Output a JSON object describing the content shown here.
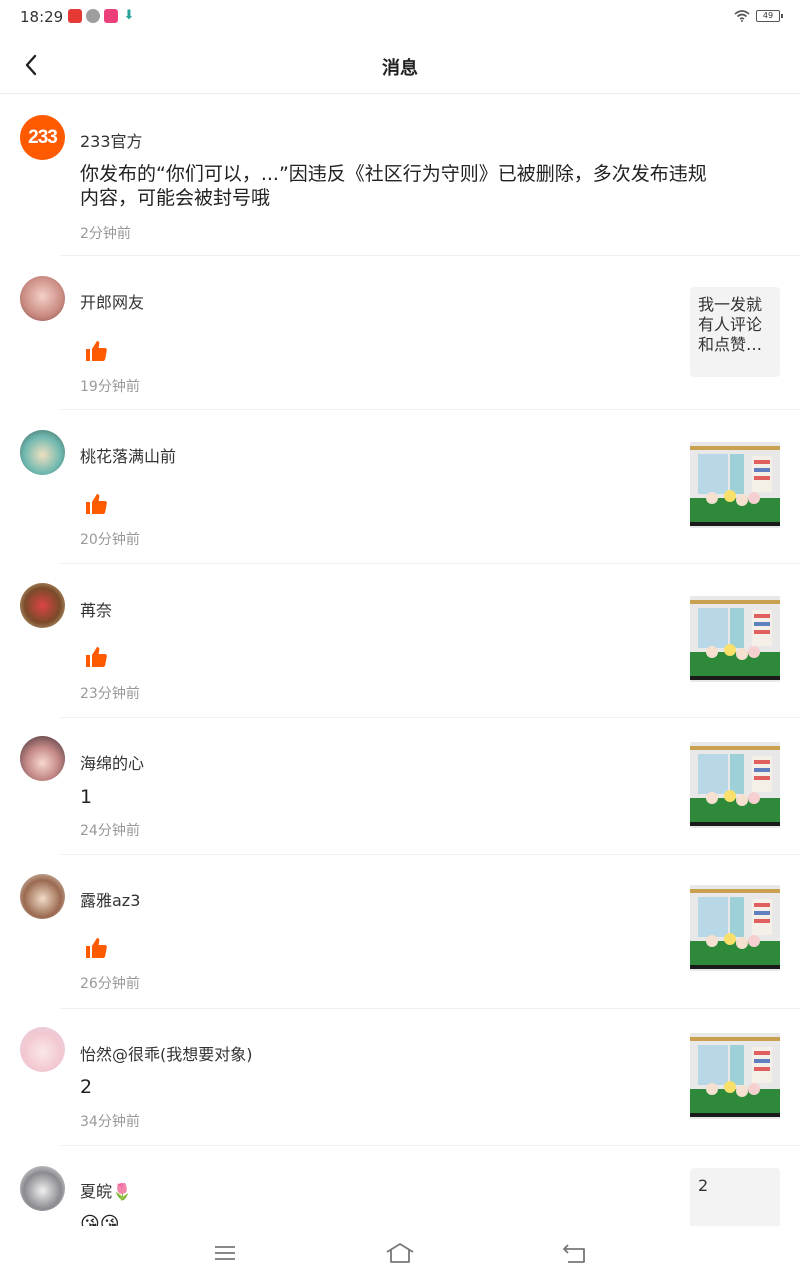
{
  "status": {
    "time": "18:29",
    "battery": "49"
  },
  "header": {
    "title": "消息"
  },
  "official": {
    "avatar_text": "233",
    "name": "233官方",
    "line1": "你发布的“你们可以，...”因违反《社区行为守则》已被删除，多次发布违规",
    "line2": "内容，可能会被封号哦",
    "time": "2分钟前"
  },
  "messages": [
    {
      "name": "开郎网友",
      "content": "",
      "liked": true,
      "time": "19分钟前",
      "thumb_text": "我一发就有人评论和点赞…"
    },
    {
      "name": "桃花落满山前",
      "content": "",
      "liked": true,
      "time": "20分钟前",
      "thumb_text": ""
    },
    {
      "name": "苒奈",
      "content": "",
      "liked": true,
      "time": "23分钟前",
      "thumb_text": ""
    },
    {
      "name": "海绵的心",
      "content": "1",
      "liked": false,
      "time": "24分钟前",
      "thumb_text": ""
    },
    {
      "name": "露雅az3",
      "content": "",
      "liked": true,
      "time": "26分钟前",
      "thumb_text": ""
    },
    {
      "name": "怡然@很乖(我想要对象)",
      "content": "2",
      "liked": false,
      "time": "34分钟前",
      "thumb_text": ""
    },
    {
      "name": "夏皖🌷",
      "content": "😘😘",
      "liked": false,
      "time": "",
      "thumb_text": "2"
    }
  ],
  "colors": {
    "accent": "#ff5a00",
    "time": "#999999",
    "divider": "#f0f0f0"
  }
}
